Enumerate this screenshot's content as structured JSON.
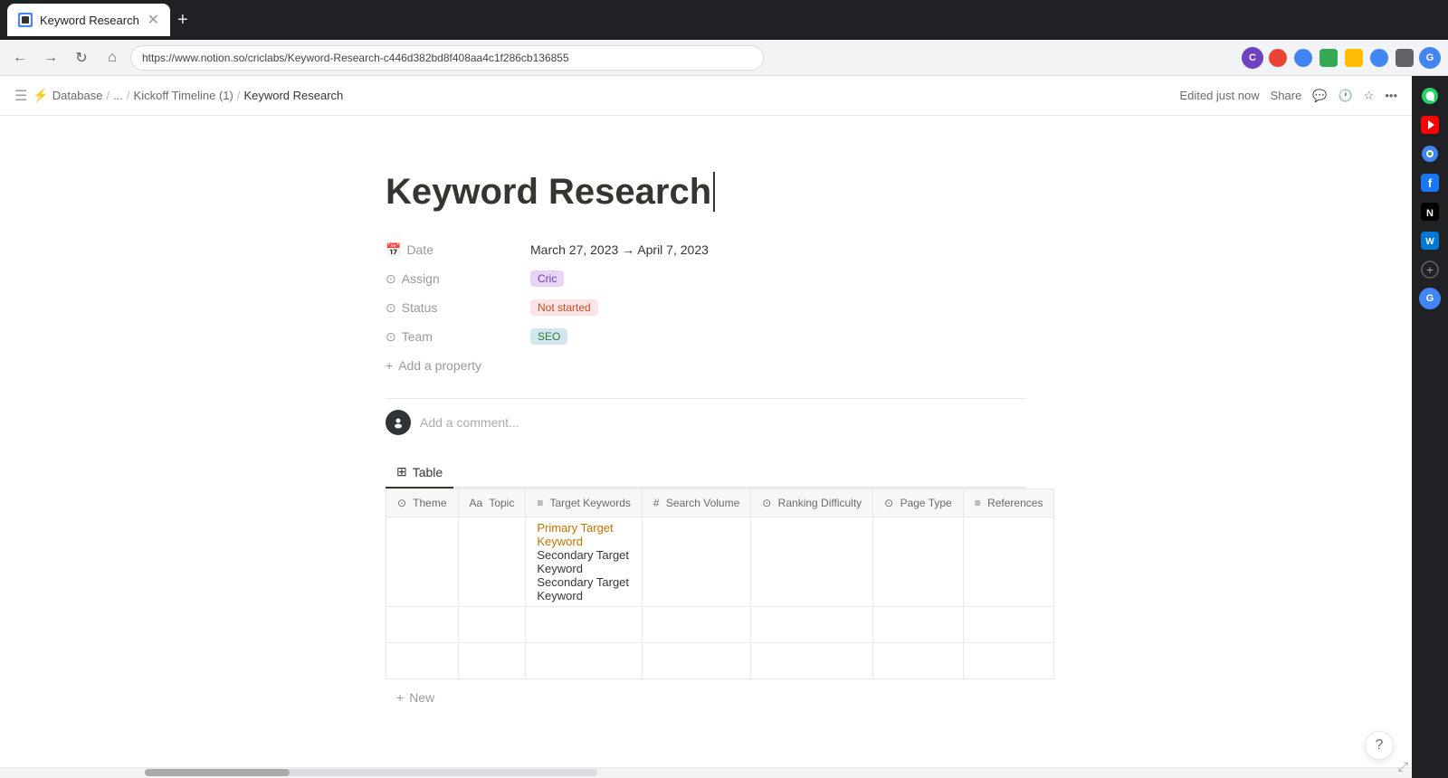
{
  "browser": {
    "tab_title": "Keyword Research",
    "tab_new_label": "+",
    "address": "https://www.notion.so/criclabs/Keyword-Research-c446d382bd8f408aa4c1f286cb136855",
    "back_btn": "←",
    "forward_btn": "→",
    "refresh_btn": "↻",
    "home_btn": "⌂"
  },
  "notion_header": {
    "breadcrumb": [
      "Database",
      "/",
      "...",
      "/",
      "Kickoff Timeline (1)",
      "/",
      "Keyword Research"
    ],
    "edited_text": "Edited just now",
    "share_label": "Share",
    "db_icon": "⚡",
    "menu_icon": "≡"
  },
  "page": {
    "title": "Keyword Research",
    "cursor": true
  },
  "properties": {
    "date_label": "Date",
    "date_icon": "📅",
    "date_value": "March 27, 2023 → April 7, 2023",
    "assign_label": "Assign",
    "assign_icon": "⊙",
    "assign_value": "Cric",
    "status_label": "Status",
    "status_icon": "⊙",
    "status_value": "Not started",
    "team_label": "Team",
    "team_icon": "⊙",
    "team_value": "SEO",
    "add_property_label": "Add a property"
  },
  "comment": {
    "avatar_text": "●",
    "placeholder": "Add a comment..."
  },
  "table": {
    "tab_label": "Table",
    "tab_icon": "⊞",
    "columns": [
      {
        "id": "theme",
        "icon": "⊙",
        "label": "Theme"
      },
      {
        "id": "topic",
        "icon": "Aa",
        "label": "Topic"
      },
      {
        "id": "keywords",
        "icon": "≡",
        "label": "Target Keywords"
      },
      {
        "id": "volume",
        "icon": "#",
        "label": "Search Volume"
      },
      {
        "id": "difficulty",
        "icon": "⊙",
        "label": "Ranking Difficulty"
      },
      {
        "id": "pagetype",
        "icon": "⊙",
        "label": "Page Type"
      },
      {
        "id": "refs",
        "icon": "≡",
        "label": "References"
      }
    ],
    "rows": [
      {
        "theme": "",
        "topic": "",
        "keywords_primary": "Primary Target Keyword",
        "keywords_secondary": [
          "Secondary Target Keyword",
          "Secondary Target Keyword"
        ],
        "volume": "",
        "difficulty": "",
        "pagetype": "",
        "refs": ""
      },
      {
        "theme": "",
        "topic": "",
        "keywords_primary": "",
        "keywords_secondary": [],
        "volume": "",
        "difficulty": "",
        "pagetype": "",
        "refs": ""
      },
      {
        "theme": "",
        "topic": "",
        "keywords_primary": "",
        "keywords_secondary": [],
        "volume": "",
        "difficulty": "",
        "pagetype": "",
        "refs": ""
      }
    ],
    "new_row_label": "New"
  },
  "help_btn_label": "?",
  "resize_icon": "⤢"
}
